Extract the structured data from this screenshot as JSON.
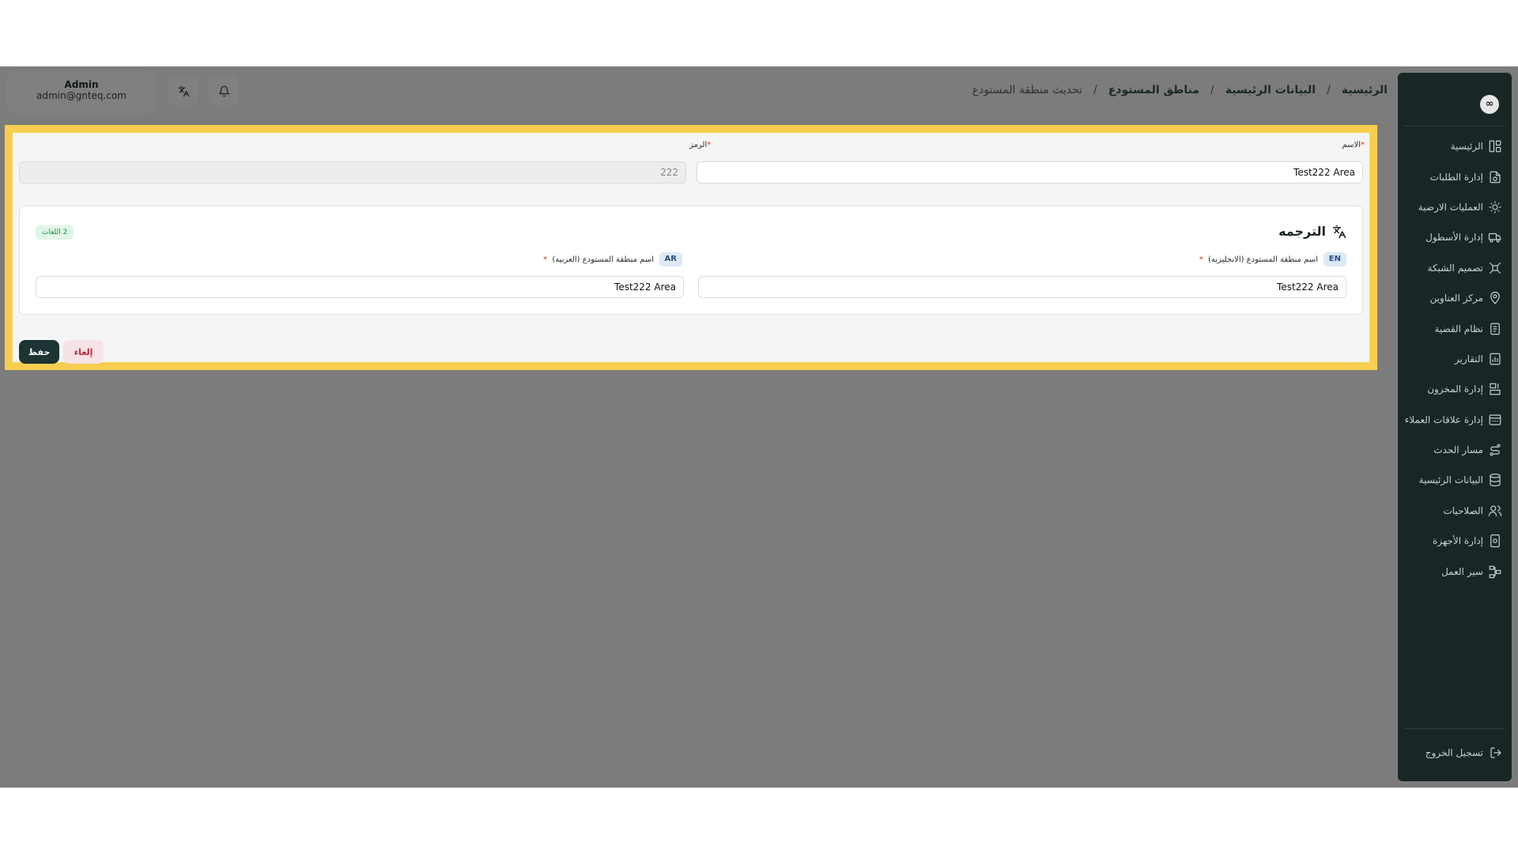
{
  "header": {
    "breadcrumb": [
      "الرئيسية",
      "البيانات الرئيسية",
      "مناطق المستودع"
    ],
    "current_page": "تحديث منطقة المستودع",
    "separator": "/"
  },
  "user": {
    "name": "Admin",
    "email": "admin@gnteq.com"
  },
  "sidebar": {
    "logo": "∞",
    "items": [
      {
        "label": "الرئيسية",
        "icon": "dashboard-icon"
      },
      {
        "label": "إدارة الطلبات",
        "icon": "orders-icon"
      },
      {
        "label": "العمليات الارضية",
        "icon": "ground-ops-icon"
      },
      {
        "label": "إدارة الأسطول",
        "icon": "truck-icon"
      },
      {
        "label": "تصميم الشبكة",
        "icon": "network-icon"
      },
      {
        "label": "مركز العناوين",
        "icon": "location-icon"
      },
      {
        "label": "نظام القضية",
        "icon": "case-icon"
      },
      {
        "label": "التقارير",
        "icon": "reports-icon"
      },
      {
        "label": "إدارة المخزون",
        "icon": "inventory-icon"
      },
      {
        "label": "إدارة علاقات العملاء",
        "icon": "crm-icon"
      },
      {
        "label": "مسار الحدث",
        "icon": "route-icon"
      },
      {
        "label": "البيانات الرئيسية",
        "icon": "database-icon"
      },
      {
        "label": "الصلاحيات",
        "icon": "users-icon"
      },
      {
        "label": "إدارة الأجهزة",
        "icon": "devices-icon"
      },
      {
        "label": "سير العمل",
        "icon": "workflow-icon"
      }
    ],
    "logout_label": "تسجيل الخروج"
  },
  "form": {
    "name_label": "الاسم",
    "name_value": "Test222 Area",
    "code_label": "الرمز",
    "code_value": "222",
    "required_mark": "*",
    "translation": {
      "title": "الترجمه",
      "languages_badge": "2 اللغات",
      "en_tag": "EN",
      "en_label": "اسم منطقة المستودع (الانجليزيه)",
      "en_value": "Test222 Area",
      "ar_tag": "AR",
      "ar_label": "اسم منطقة المستودع (العربيه)",
      "ar_value": "Test222 Area"
    },
    "save_label": "حفظ",
    "cancel_label": "إلغاء"
  },
  "colors": {
    "sidebar_bg": "#182726",
    "overlay_bg": "#7b7c7b",
    "highlight": "#f7ce4f",
    "primary_button": "#1c3433",
    "cancel_text": "#c8263a"
  }
}
